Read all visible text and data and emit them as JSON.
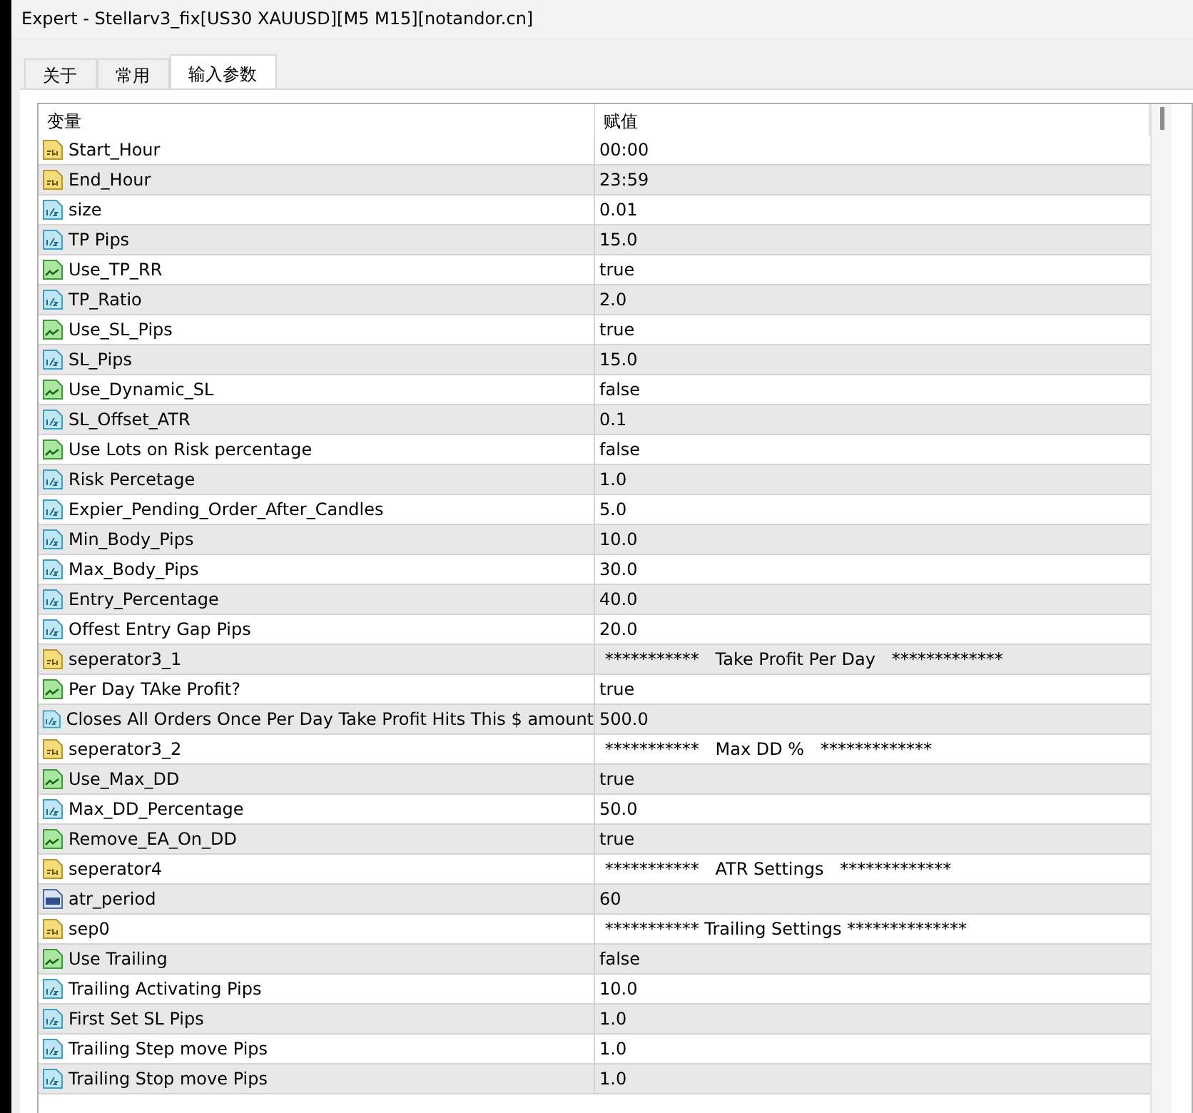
{
  "window": {
    "title": "Expert - Stellarv3_fix[US30 XAUUSD][M5 M15][notandor.cn]"
  },
  "tabs": [
    {
      "label": "关于",
      "selected": false
    },
    {
      "label": "常用",
      "selected": false
    },
    {
      "label": "输入参数",
      "selected": true
    }
  ],
  "table": {
    "columns": [
      "变量",
      "赋值"
    ],
    "rows": [
      {
        "kind": "text",
        "name": "Start_Hour",
        "value": "00:00"
      },
      {
        "kind": "text",
        "name": "End_Hour",
        "value": "23:59"
      },
      {
        "kind": "double",
        "name": "size",
        "value": "0.01"
      },
      {
        "kind": "double",
        "name": "TP Pips",
        "value": "15.0"
      },
      {
        "kind": "bool",
        "name": "Use_TP_RR",
        "value": "true"
      },
      {
        "kind": "double",
        "name": "TP_Ratio",
        "value": "2.0"
      },
      {
        "kind": "bool",
        "name": "Use_SL_Pips",
        "value": "true"
      },
      {
        "kind": "double",
        "name": "SL_Pips",
        "value": "15.0"
      },
      {
        "kind": "bool",
        "name": "Use_Dynamic_SL",
        "value": "false"
      },
      {
        "kind": "double",
        "name": "SL_Offset_ATR",
        "value": "0.1"
      },
      {
        "kind": "bool",
        "name": "Use Lots on Risk percentage",
        "value": "false"
      },
      {
        "kind": "double",
        "name": "Risk Percetage",
        "value": "1.0"
      },
      {
        "kind": "double",
        "name": "Expier_Pending_Order_After_Candles",
        "value": "5.0"
      },
      {
        "kind": "double",
        "name": "Min_Body_Pips",
        "value": "10.0"
      },
      {
        "kind": "double",
        "name": "Max_Body_Pips",
        "value": "30.0"
      },
      {
        "kind": "double",
        "name": "Entry_Percentage",
        "value": "40.0"
      },
      {
        "kind": "double",
        "name": "Offest Entry Gap Pips",
        "value": "20.0"
      },
      {
        "kind": "text",
        "name": "seperator3_1",
        "value": " ***********   Take Profit Per Day   *************"
      },
      {
        "kind": "bool",
        "name": "Per Day TAke Profit?",
        "value": "true"
      },
      {
        "kind": "double",
        "name": "Closes All Orders Once Per Day Take Profit Hits This $ amount",
        "value": "500.0"
      },
      {
        "kind": "text",
        "name": "seperator3_2",
        "value": " ***********   Max DD %   *************"
      },
      {
        "kind": "bool",
        "name": "Use_Max_DD",
        "value": "true"
      },
      {
        "kind": "double",
        "name": "Max_DD_Percentage",
        "value": "50.0"
      },
      {
        "kind": "bool",
        "name": "Remove_EA_On_DD",
        "value": "true"
      },
      {
        "kind": "text",
        "name": "seperator4",
        "value": " ***********   ATR Settings   *************"
      },
      {
        "kind": "int",
        "name": "atr_period",
        "value": "60"
      },
      {
        "kind": "text",
        "name": "sep0",
        "value": " *********** Trailing Settings **************"
      },
      {
        "kind": "bool",
        "name": "Use Trailing",
        "value": "false"
      },
      {
        "kind": "double",
        "name": "Trailing Activating Pips",
        "value": "10.0"
      },
      {
        "kind": "double",
        "name": "First Set SL  Pips",
        "value": "1.0"
      },
      {
        "kind": "double",
        "name": "Trailing Step move Pips",
        "value": "1.0"
      },
      {
        "kind": "double",
        "name": "Trailing Stop move Pips",
        "value": "1.0"
      }
    ]
  }
}
